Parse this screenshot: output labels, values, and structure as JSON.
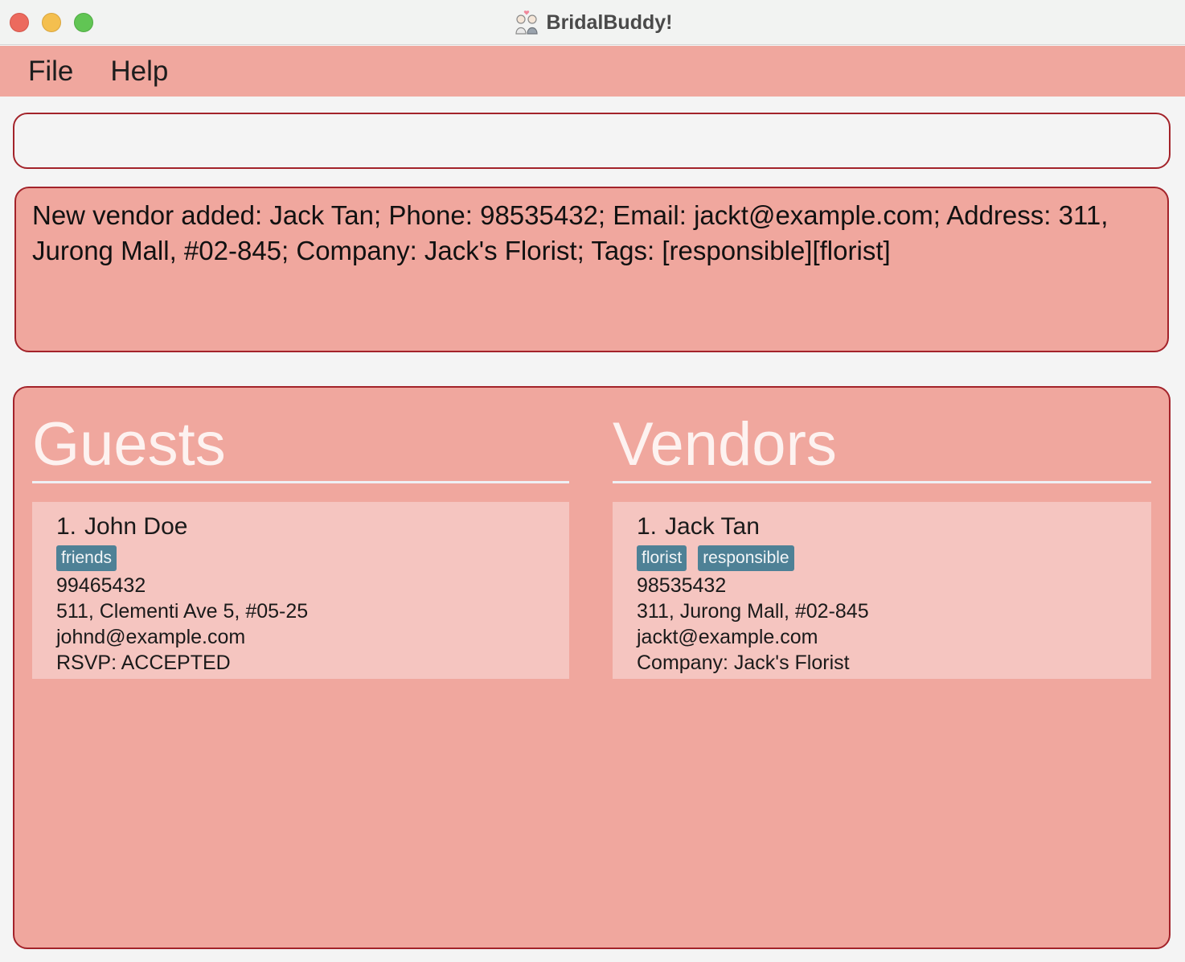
{
  "window": {
    "title": "BridalBuddy!"
  },
  "menu": {
    "items": [
      "File",
      "Help"
    ]
  },
  "command": {
    "value": "",
    "placeholder": ""
  },
  "result": {
    "message": "New vendor added: Jack Tan; Phone: 98535432; Email: jackt@example.com; Address: 311, Jurong Mall, #02-845; Company: Jack's Florist; Tags: [responsible][florist]"
  },
  "guests": {
    "heading": "Guests",
    "items": [
      {
        "index": "1.",
        "name": "John Doe",
        "tags": [
          "friends"
        ],
        "phone": "99465432",
        "address": "511, Clementi Ave 5, #05-25",
        "email": "johnd@example.com",
        "extra": "RSVP: ACCEPTED"
      }
    ]
  },
  "vendors": {
    "heading": "Vendors",
    "items": [
      {
        "index": "1.",
        "name": "Jack Tan",
        "tags": [
          "florist",
          "responsible"
        ],
        "phone": "98535432",
        "address": "311, Jurong Mall, #02-845",
        "email": "jackt@example.com",
        "extra": "Company: Jack's Florist"
      }
    ]
  },
  "colors": {
    "accent": "#f0a79e",
    "border": "#a3232a",
    "card": "#f5c5c0",
    "tag": "#4e8196"
  },
  "icons": {
    "app": "bride-and-groom-icon"
  }
}
